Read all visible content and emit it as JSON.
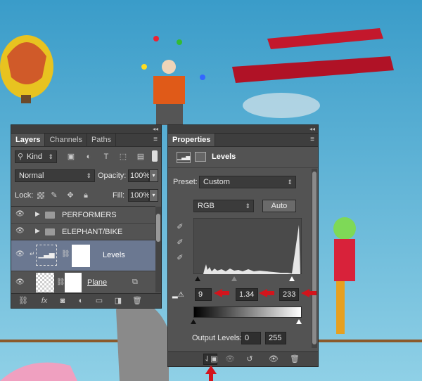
{
  "layers_panel": {
    "tabs": [
      "Layers",
      "Channels",
      "Paths"
    ],
    "kind_label": "Kind",
    "blend_mode": "Normal",
    "opacity_label": "Opacity:",
    "opacity_value": "100%",
    "lock_label": "Lock:",
    "fill_label": "Fill:",
    "fill_value": "100%",
    "layers": [
      {
        "name": "PERFORMERS",
        "type": "group"
      },
      {
        "name": "ELEPHANT/BIKE",
        "type": "group"
      },
      {
        "name": "Levels",
        "type": "adjustment"
      },
      {
        "name": "Plane",
        "type": "layer"
      }
    ]
  },
  "properties_panel": {
    "tab": "Properties",
    "adjustment_name": "Levels",
    "preset_label": "Preset:",
    "preset_value": "Custom",
    "channel_value": "RGB",
    "auto_button": "Auto",
    "input_levels": {
      "black": "9",
      "gamma": "1.34",
      "white": "233"
    },
    "output_levels_label": "Output Levels:",
    "output_levels": {
      "black": "0",
      "white": "255"
    }
  },
  "colors": {
    "panel_bg": "#535353",
    "panel_dark": "#3e3e3e",
    "annotation_arrow": "#d3141c",
    "selected_layer": "#6b7891"
  }
}
